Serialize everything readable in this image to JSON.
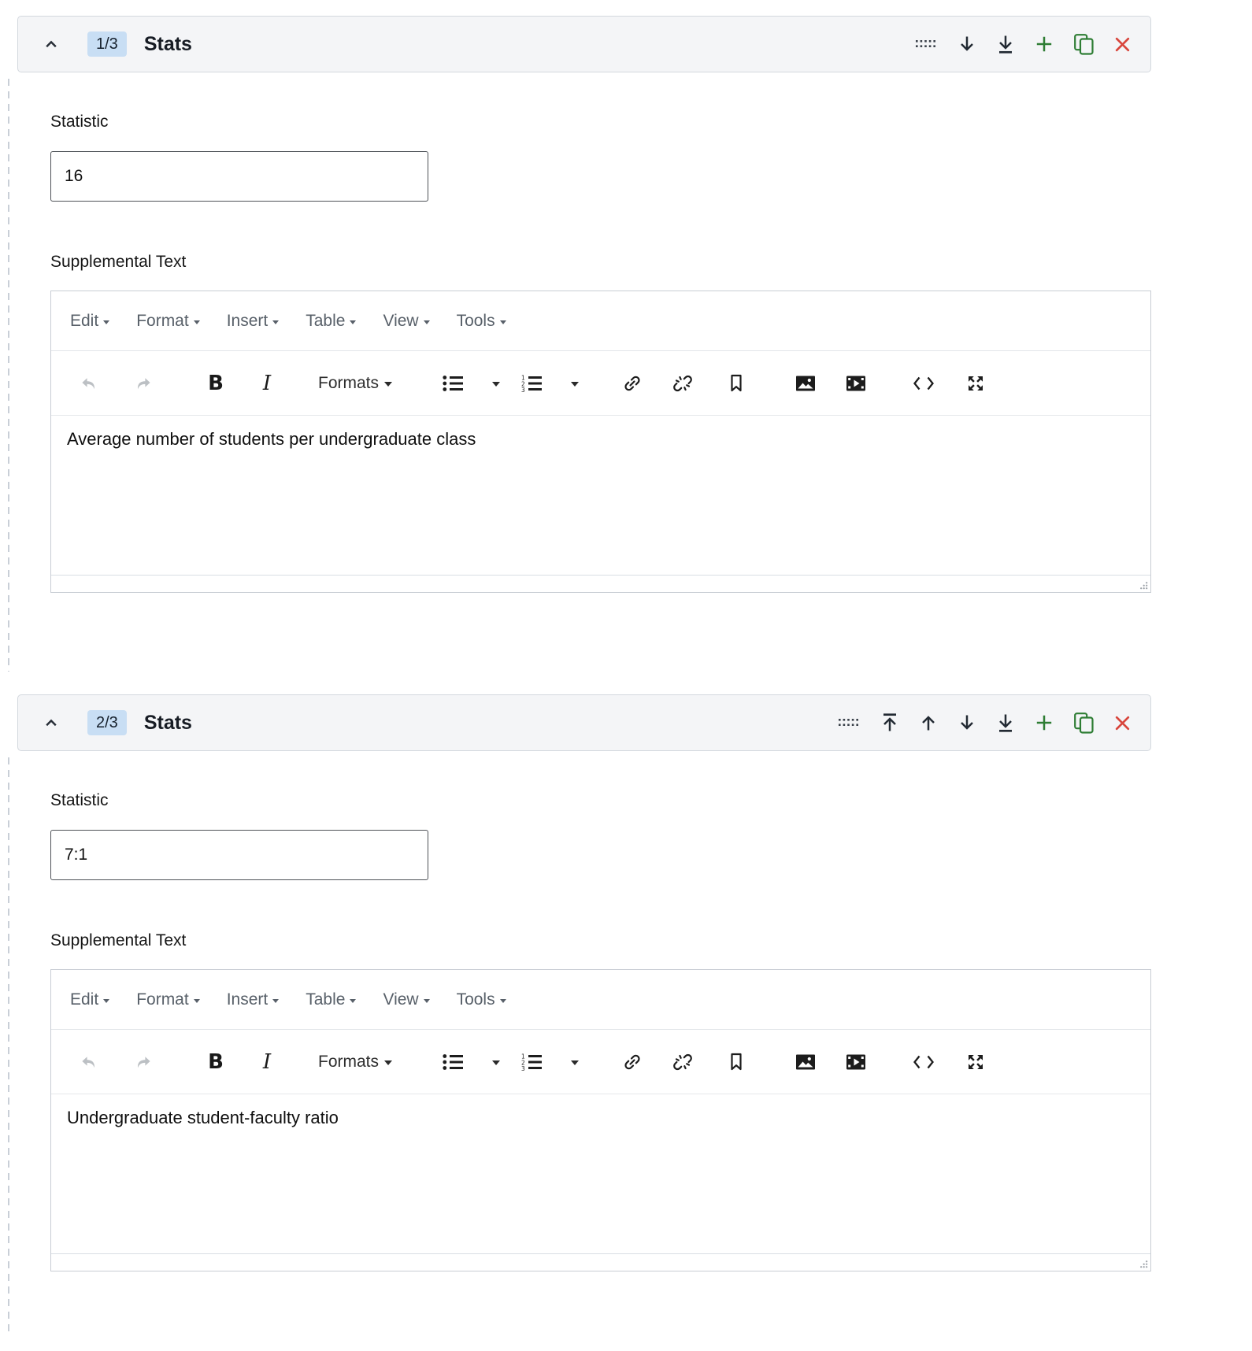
{
  "blocks": [
    {
      "badge": "1/3",
      "title": "Stats",
      "statistic": {
        "label": "Statistic",
        "value": "16"
      },
      "supplemental": {
        "label": "Supplemental Text",
        "content": "Average number of students per undergraduate class"
      },
      "header_tools": [
        "drag-handle",
        "move-down",
        "move-to-bottom",
        "add",
        "duplicate",
        "remove"
      ]
    },
    {
      "badge": "2/3",
      "title": "Stats",
      "statistic": {
        "label": "Statistic",
        "value": "7:1"
      },
      "supplemental": {
        "label": "Supplemental Text",
        "content": "Undergraduate student-faculty ratio"
      },
      "header_tools": [
        "drag-handle",
        "move-to-top",
        "move-up",
        "move-down",
        "move-to-bottom",
        "add",
        "duplicate",
        "remove"
      ]
    }
  ],
  "editor_menu": {
    "items": [
      "Edit",
      "Format",
      "Insert",
      "Table",
      "View",
      "Tools"
    ]
  },
  "editor_toolbar": {
    "bold_label": "B",
    "italic_label": "I",
    "formats_label": "Formats",
    "buttons": [
      "undo",
      "redo",
      "bold",
      "italic",
      "formats",
      "bullet-list",
      "numbered-list",
      "link",
      "unlink",
      "anchor",
      "image",
      "media",
      "source-code",
      "fullscreen"
    ]
  },
  "colors": {
    "accent_green": "#2e7d34",
    "danger_red": "#d8453c",
    "badge_bg": "#c8def4",
    "header_bg": "#f4f5f7"
  }
}
